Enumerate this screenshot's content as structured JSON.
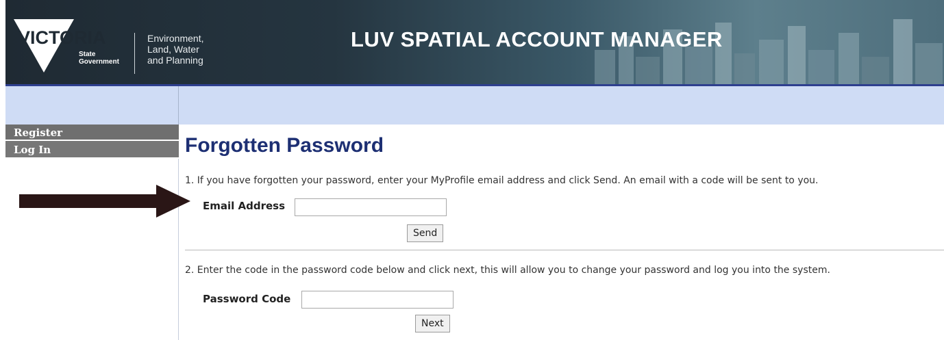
{
  "header": {
    "logo_main": "VICTORIA",
    "logo_sub_lines": [
      "State",
      "Government"
    ],
    "department_lines": [
      "Environment,",
      "Land, Water",
      "and Planning"
    ],
    "app_title": "LUV SPATIAL ACCOUNT MANAGER"
  },
  "sidebar": {
    "items": [
      {
        "label": "Register"
      },
      {
        "label": "Log In"
      }
    ]
  },
  "main": {
    "title": "Forgotten Password",
    "step1": {
      "instruction": "1. If you have forgotten your password, enter your MyProfile email address and click Send. An email with a code will be sent to you.",
      "field_label": "Email Address",
      "field_value": "",
      "button_label": "Send"
    },
    "step2": {
      "instruction": "2. Enter the code in the password code below and click next, this will allow you to change your password and log you into the system.",
      "field_label": "Password Code",
      "field_value": "",
      "button_label": "Next"
    }
  },
  "colors": {
    "title": "#1d2f73",
    "band": "#cfdcf5",
    "nav": "#777777",
    "arrow": "#2a1616"
  }
}
